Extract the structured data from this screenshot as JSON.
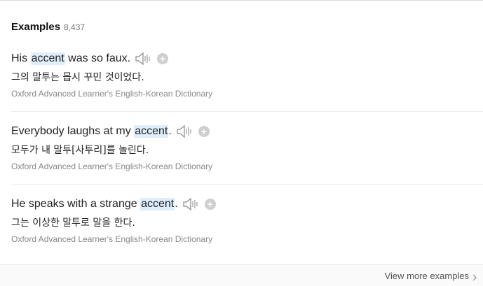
{
  "header": {
    "title": "Examples",
    "count": "8,437"
  },
  "examples": [
    {
      "before": "His ",
      "highlight": "accent",
      "after": " was so faux.",
      "korean": "그의 말투는 몹시 꾸민 것이었다.",
      "source": "Oxford Advanced Learner's English-Korean Dictionary"
    },
    {
      "before": "Everybody laughs at my ",
      "highlight": "accent",
      "after": ".",
      "korean": "모두가 내 말투[사투리]를 놀린다.",
      "source": "Oxford Advanced Learner's English-Korean Dictionary"
    },
    {
      "before": "He speaks with a strange ",
      "highlight": "accent",
      "after": ".",
      "korean": "그는 이상한 말투로 말을 한다.",
      "source": "Oxford Advanced Learner's English-Korean Dictionary"
    }
  ],
  "icons": {
    "speaker": "speaker-icon",
    "add": "plus-icon",
    "chevron": "chevron-right-icon"
  },
  "colors": {
    "highlight": "#dfeefc",
    "secondary_text": "#888888"
  },
  "footer": {
    "more_label": "View more examples"
  }
}
